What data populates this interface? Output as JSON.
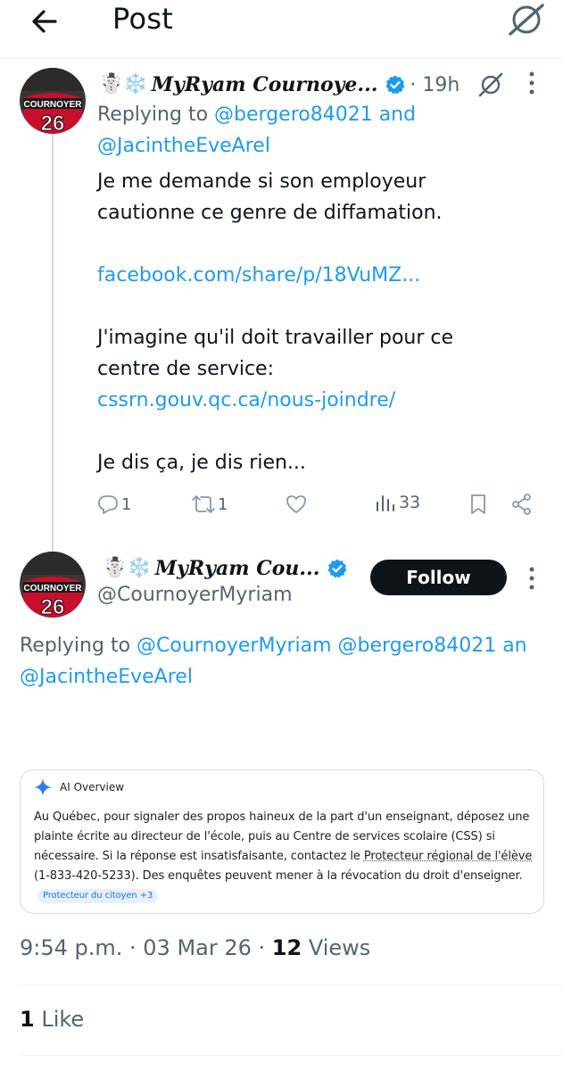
{
  "header": {
    "title": "Post",
    "back_icon": "arrow-left-icon",
    "grok_icon": "grok-icon"
  },
  "tweet1": {
    "emoji": "☃️❄️",
    "display_name": "𝑴𝒚𝑹𝒚𝒂𝒎 𝑪𝒐𝒖𝒓𝒏𝒐𝒚𝒆...",
    "time": "· 19h",
    "replying_prefix": "Replying to ",
    "mention1": "@bergero84021",
    "replying_and": " and",
    "mention2": "@JacintheEveArel",
    "text1": "Je me demande si son employeur cautionne ce genre de diffamation.",
    "link1": "facebook.com/share/p/18VuMZ...",
    "text2": "J'imagine qu'il doit travailler pour ce centre de service:",
    "link2": "cssrn.gouv.qc.ca/nous-joindre/",
    "text3": "Je dis ça, je dis rien...",
    "replies": "1",
    "reposts": "1",
    "views": "33"
  },
  "tweet2": {
    "emoji": "☃️❄️",
    "display_name": "𝑴𝒚𝑹𝒚𝒂𝒎 𝑪𝒐𝒖...",
    "handle": "@CournoyerMyriam",
    "follow_label": "Follow",
    "replying_prefix": "Replying to ",
    "mention1": "@CournoyerMyriam",
    "mention2": "@bergero84021",
    "mention2_tail": " an",
    "mention3": "@JacintheEveArel",
    "ai_overview": {
      "title": "AI Overview",
      "text_before": "Au Québec, pour signaler des propos haineux de la part d'un enseignant, déposez une plainte écrite au directeur de l'école, puis au Centre de services scolaire (CSS) si nécessaire. Si la réponse est insatisfaisante, contactez le ",
      "text_underlined": "Protecteur régional de l'élève",
      "text_after": " (1-833-420-5233). Des enquêtes peuvent mener à la révocation du droit d'enseigner.",
      "source_chip": "Protecteur du citoyen +3"
    },
    "meta_time": "9:54 p.m. · 03 Mar 26 · ",
    "views_count": "12",
    "views_label": " Views",
    "likes_count": "1",
    "likes_label": " Like"
  },
  "colors": {
    "accent": "#1d9bf0",
    "secondary_text": "#536471",
    "primary_text": "#0f1419",
    "verified": "#1d9bf0"
  },
  "avatar_jersey": {
    "name": "COURNOYER",
    "number": "26"
  }
}
